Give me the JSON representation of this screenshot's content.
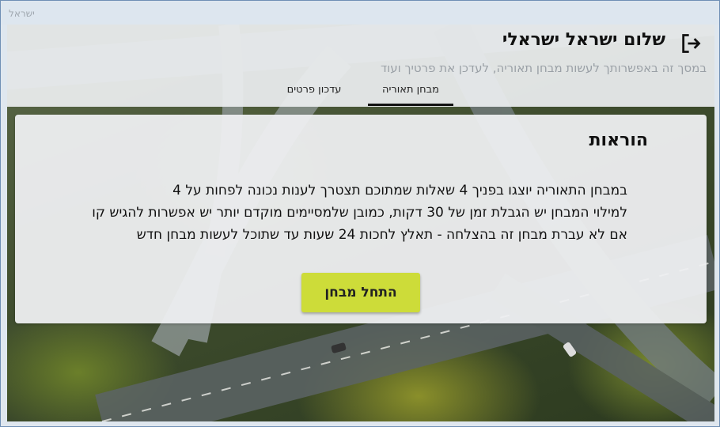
{
  "window": {
    "title": "ישראל"
  },
  "header": {
    "greeting": "שלום ישראל ישראלי",
    "subtitle": "במסך זה באפשרותך לעשות מבחן תאוריה, לעדכן את פרטיך ועוד",
    "logout_icon": "logout-icon"
  },
  "tabs": [
    {
      "label": "מבחן תאוריה",
      "active": true
    },
    {
      "label": "עדכון פרטים",
      "active": false
    }
  ],
  "card": {
    "title": "הוראות",
    "lines": [
      "במבחן התאוריה יוצגו בפניך 4 שאלות שמתוכם תצטרך לענות נכונה לפחות על 4",
      "למילוי המבחן יש הגבלת זמן של 30 דקות, כמובן שלמסיימים מוקדם יותר יש אפשרות להגיש קו",
      "אם לא עברת מבחן זה בהצלחה - תאלץ לחכות 24 שעות עד שתוכל לעשות מבחן חדש"
    ],
    "start_button": "התחל מבחן"
  },
  "colors": {
    "accent": "#cddc39",
    "tab_indicator": "#111111"
  }
}
